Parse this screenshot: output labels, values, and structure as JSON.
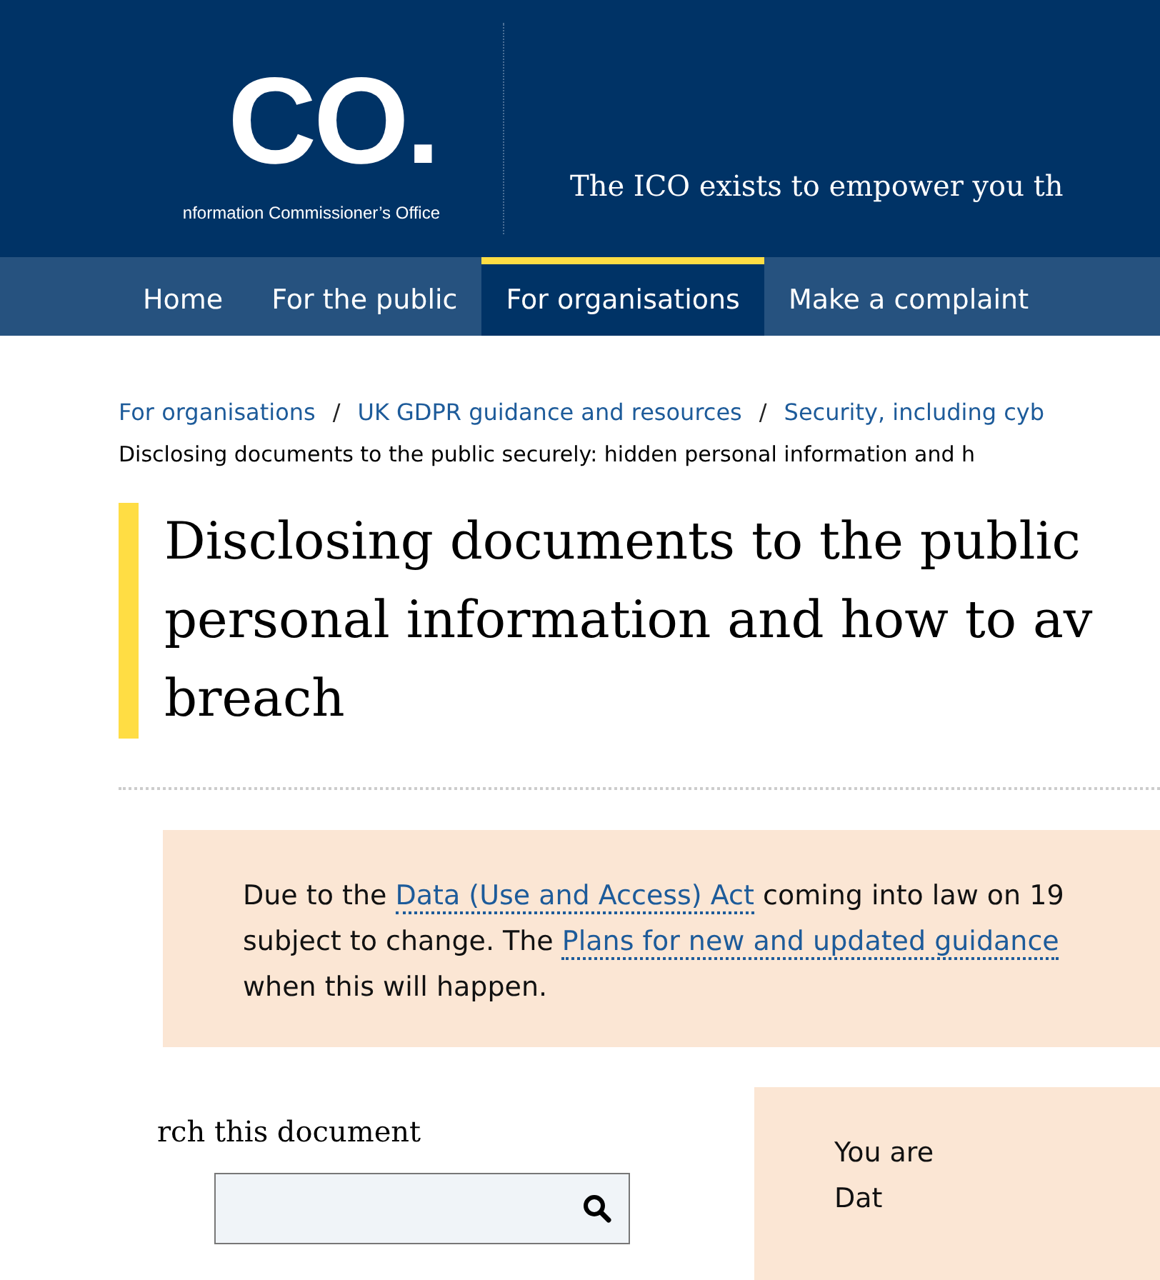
{
  "header": {
    "logo": "CO.",
    "logo_subtitle": "nformation Commissioner’s Office",
    "tagline": "The ICO exists to empower you th"
  },
  "nav": [
    {
      "label": "Home",
      "selected": false
    },
    {
      "label": "For the public",
      "selected": false
    },
    {
      "label": "For organisations",
      "selected": true
    },
    {
      "label": "Make a complaint",
      "selected": false
    }
  ],
  "breadcrumb": {
    "separator": "/",
    "links": [
      "For organisations",
      "UK GDPR guidance and resources",
      "Security, including cyb"
    ],
    "current": "Disclosing documents to the public securely: hidden personal information and h"
  },
  "title_lines": [
    "Disclosing documents to the public",
    "personal information and how to av",
    "breach"
  ],
  "notice": [
    {
      "kind": "text",
      "text": "Due to the "
    },
    {
      "kind": "link",
      "text": "Data (Use and Access) Act"
    },
    {
      "kind": "text",
      "text": " coming into law on 19"
    },
    {
      "kind": "break"
    },
    {
      "kind": "text",
      "text": "subject to change. The "
    },
    {
      "kind": "link",
      "text": "Plans for new and updated guidance"
    },
    {
      "kind": "break"
    },
    {
      "kind": "text",
      "text": "when this will happen."
    }
  ],
  "search": {
    "label": "rch this document"
  },
  "side_box": {
    "lines": [
      "You are",
      "Dat"
    ]
  }
}
